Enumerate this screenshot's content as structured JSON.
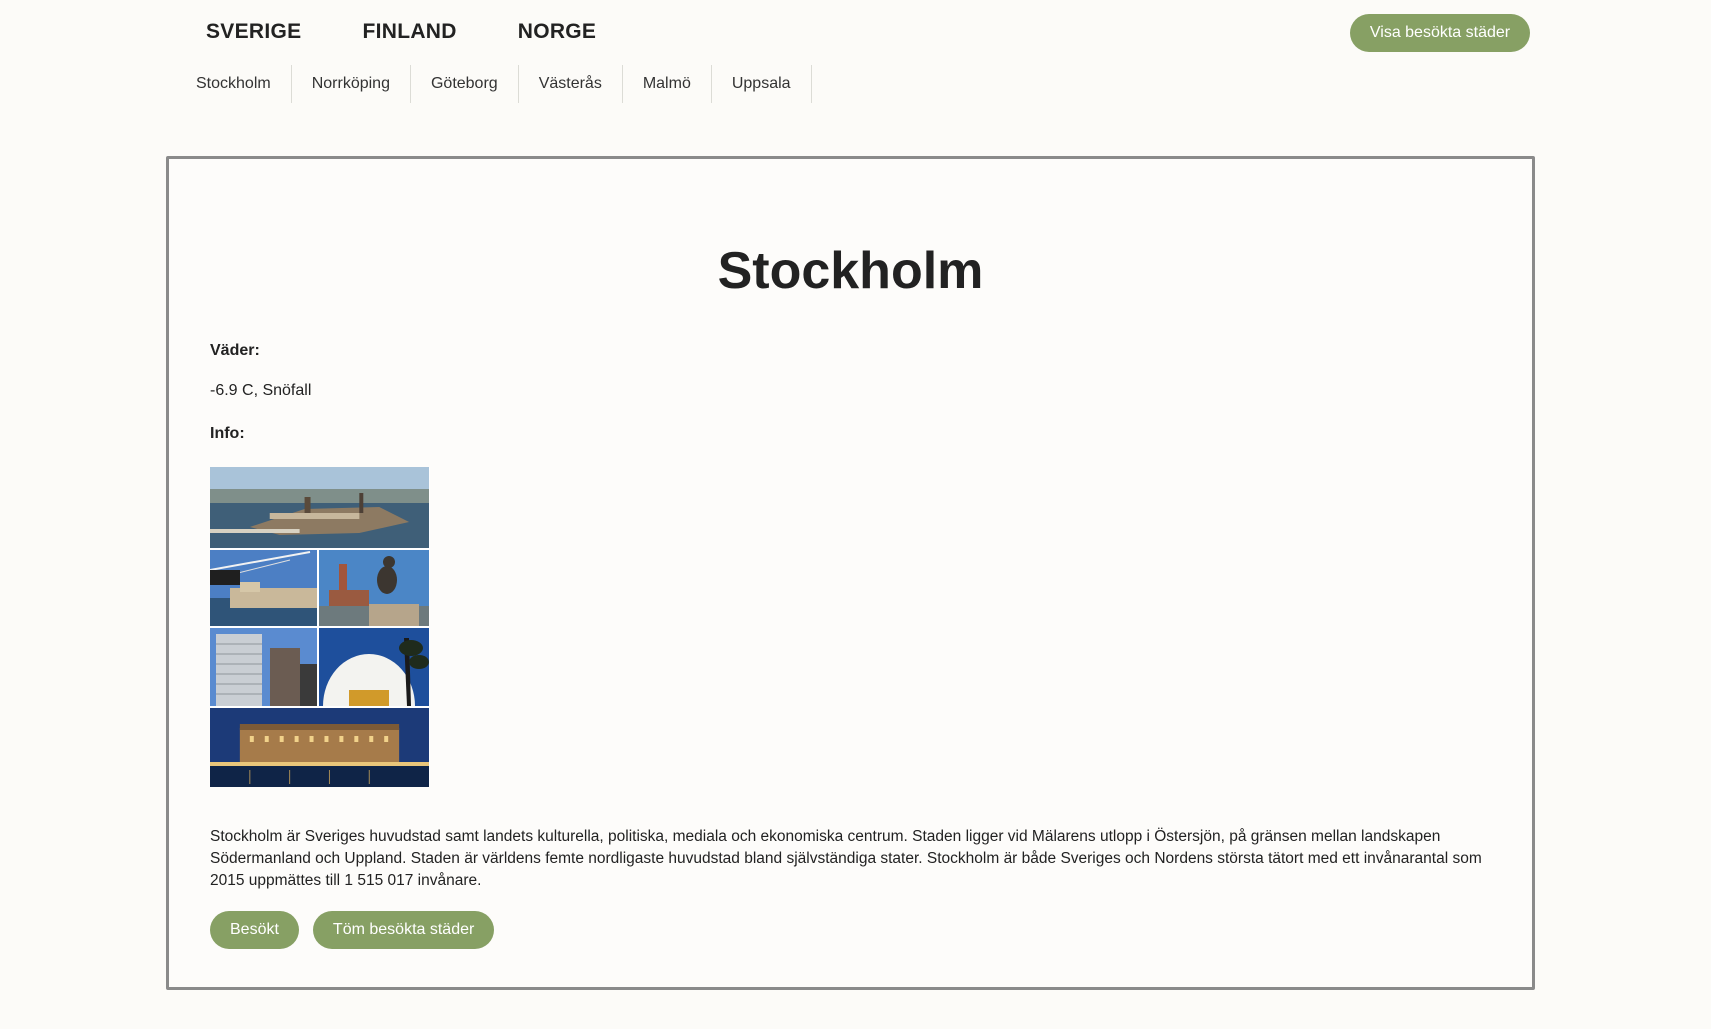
{
  "countries": [
    "SVERIGE",
    "FINLAND",
    "NORGE"
  ],
  "visited_button": "Visa besökta städer",
  "cities": [
    "Stockholm",
    "Norrköping",
    "Göteborg",
    "Västerås",
    "Malmö",
    "Uppsala"
  ],
  "city": {
    "name": "Stockholm",
    "weather_label": "Väder:",
    "weather": "-6.9 C, Snöfall",
    "info_label": "Info:",
    "description": "Stockholm är Sveriges huvudstad samt landets kulturella, politiska, mediala och ekonomiska centrum. Staden ligger vid Mälarens utlopp i Östersjön, på gränsen mellan landskapen Södermanland och Uppland. Staden är världens femte nordligaste huvudstad bland självständiga stater. Stockholm är både Sveriges och Nordens största tätort med ett invånarantal som 2015 uppmättes till 1 515 017 invånare."
  },
  "actions": {
    "visited": "Besökt",
    "clear": "Töm besökta städer"
  },
  "colors": {
    "accent": "#87a064",
    "background": "#fcfbf8",
    "card_border": "#8a8a8a"
  }
}
